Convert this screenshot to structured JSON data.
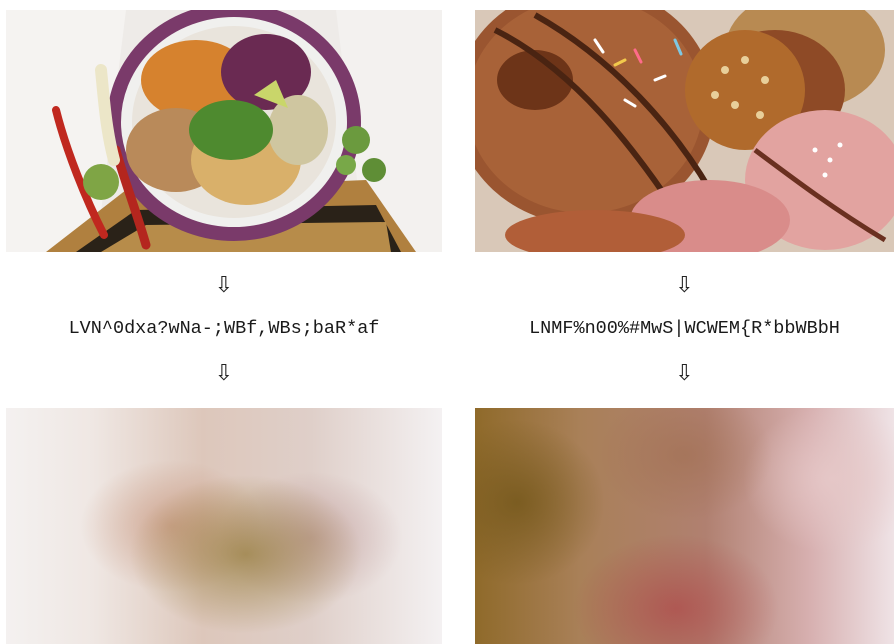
{
  "left": {
    "photo_icon": "salad-bowl-photo",
    "arrow_1": "⇩",
    "hash": "LVN^0dxa?wNa-;WBf,WBs;baR*af",
    "arrow_2": "⇩",
    "blur_icon": "blurred-placeholder-image"
  },
  "right": {
    "photo_icon": "donuts-photo",
    "arrow_1": "⇩",
    "hash": "LNMF%n00%#MwS|WCWEM{R*bbWBbH",
    "arrow_2": "⇩",
    "blur_icon": "blurred-placeholder-image"
  },
  "colors": {
    "background": "#ffffff",
    "text": "#1a1a1a"
  }
}
